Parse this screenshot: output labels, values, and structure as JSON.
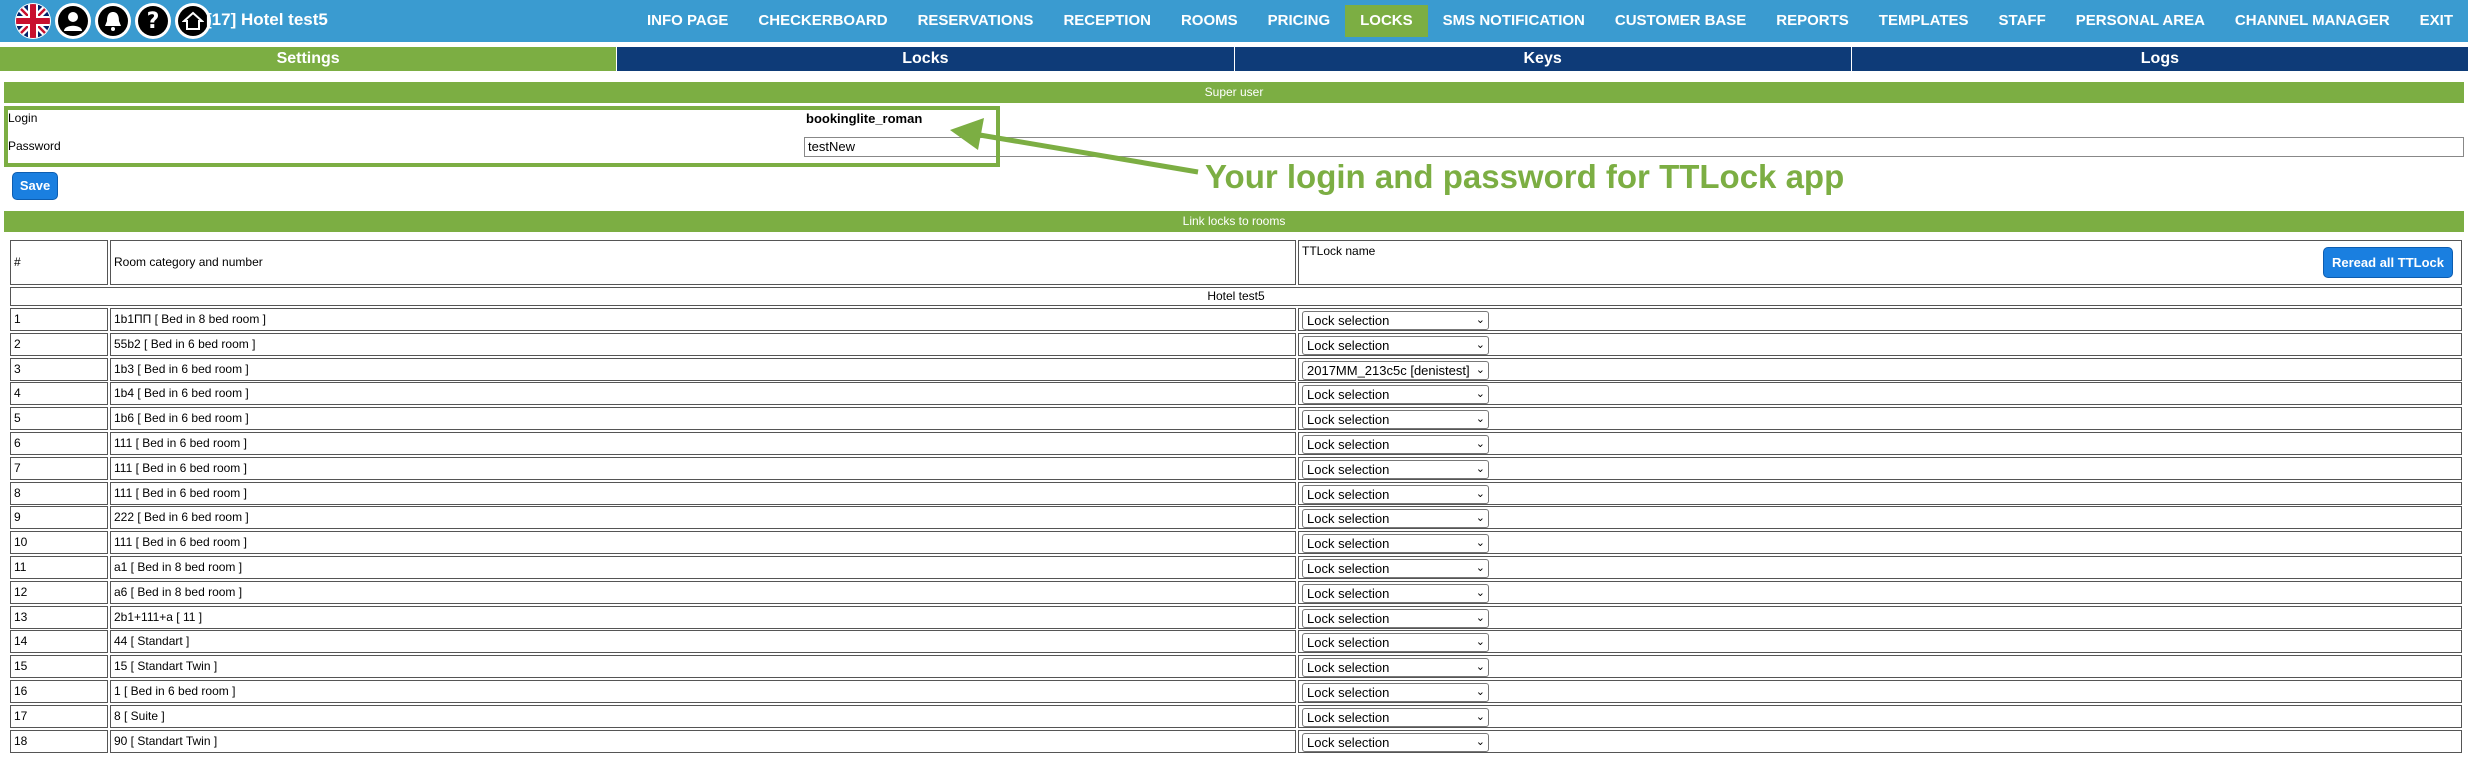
{
  "topbar": {
    "hotel_title": "[17] Hotel test5",
    "icons": [
      "flag-uk-icon",
      "user-icon",
      "bell-icon",
      "help-icon",
      "home-icon"
    ],
    "menu": [
      {
        "label": "INFO PAGE",
        "active": false
      },
      {
        "label": "CHECKERBOARD",
        "active": false
      },
      {
        "label": "RESERVATIONS",
        "active": false
      },
      {
        "label": "RECEPTION",
        "active": false
      },
      {
        "label": "ROOMS",
        "active": false
      },
      {
        "label": "PRICING",
        "active": false
      },
      {
        "label": "LOCKS",
        "active": true
      },
      {
        "label": "SMS NOTIFICATION",
        "active": false
      },
      {
        "label": "CUSTOMER BASE",
        "active": false
      },
      {
        "label": "REPORTS",
        "active": false
      },
      {
        "label": "TEMPLATES",
        "active": false
      },
      {
        "label": "STAFF",
        "active": false
      },
      {
        "label": "PERSONAL AREA",
        "active": false
      },
      {
        "label": "CHANNEL MANAGER",
        "active": false
      },
      {
        "label": "EXIT",
        "active": false
      }
    ]
  },
  "subtabs": [
    {
      "label": "Settings",
      "active": true
    },
    {
      "label": "Locks",
      "active": false
    },
    {
      "label": "Keys",
      "active": false
    },
    {
      "label": "Logs",
      "active": false
    }
  ],
  "super_user": {
    "header": "Super user",
    "login_label": "Login",
    "login_value": "bookinglite_roman",
    "password_label": "Password",
    "password_value": "testNew",
    "save_label": "Save"
  },
  "annotation": "Your login and password for TTLock app",
  "locks": {
    "header": "Link locks to rooms",
    "col_num": "#",
    "col_room": "Room category and number",
    "col_ttlock": "TTLock name",
    "reread_label": "Reread all TTLock",
    "group_label": "Hotel test5",
    "rows": [
      {
        "num": "1",
        "room": "1b1ПП [ Bed in 8 bed room ]",
        "lock": "Lock selection"
      },
      {
        "num": "2",
        "room": "55b2 [ Bed in 6 bed room ]",
        "lock": "Lock selection"
      },
      {
        "num": "3",
        "room": "1b3 [ Bed in 6 bed room ]",
        "lock": "2017MM_213c5c [denistest]"
      },
      {
        "num": "4",
        "room": "1b4 [ Bed in 6 bed room ]",
        "lock": "Lock selection"
      },
      {
        "num": "5",
        "room": "1b6 [ Bed in 6 bed room ]",
        "lock": "Lock selection"
      },
      {
        "num": "6",
        "room": "111 [ Bed in 6 bed room ]",
        "lock": "Lock selection"
      },
      {
        "num": "7",
        "room": "111 [ Bed in 6 bed room ]",
        "lock": "Lock selection"
      },
      {
        "num": "8",
        "room": "111 [ Bed in 6 bed room ]",
        "lock": "Lock selection"
      },
      {
        "num": "9",
        "room": "222 [ Bed in 6 bed room ]",
        "lock": "Lock selection"
      },
      {
        "num": "10",
        "room": "111 [ Bed in 6 bed room ]",
        "lock": "Lock selection"
      },
      {
        "num": "11",
        "room": "a1 [ Bed in 8 bed room ]",
        "lock": "Lock selection"
      },
      {
        "num": "12",
        "room": "a6 [ Bed in 8 bed room ]",
        "lock": "Lock selection"
      },
      {
        "num": "13",
        "room": "2b1+111+a [ 11 ]",
        "lock": "Lock selection"
      },
      {
        "num": "14",
        "room": "44 [ Standart ]",
        "lock": "Lock selection"
      },
      {
        "num": "15",
        "room": "15 [ Standart Twin ]",
        "lock": "Lock selection"
      },
      {
        "num": "16",
        "room": "1 [ Bed in 6 bed room ]",
        "lock": "Lock selection"
      },
      {
        "num": "17",
        "room": "8 [ Suite ]",
        "lock": "Lock selection"
      },
      {
        "num": "18",
        "room": "90 [ Standart Twin ]",
        "lock": "Lock selection"
      }
    ]
  },
  "colors": {
    "topbar": "#3a9bd0",
    "accent_green": "#7cae43",
    "tab_navy": "#0e3b78",
    "button_blue": "#1a7fe0"
  }
}
